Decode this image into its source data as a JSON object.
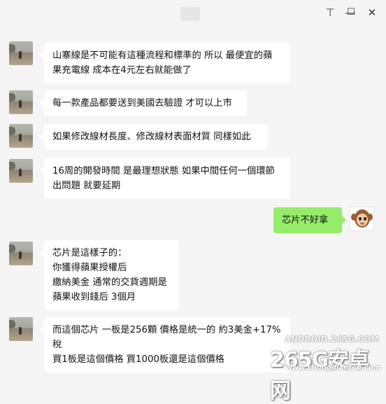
{
  "window": {
    "controls": {
      "pin": "⊤",
      "minimize": "—",
      "maximize": "☐",
      "close": "✕"
    }
  },
  "messages": [
    {
      "side": "left",
      "avatar": "beach-avatar",
      "text": "山寨線是不可能有這種流程和標準的 所以 最便宜的蘋\n果充電線 成本在4元左右就能做了"
    },
    {
      "side": "left",
      "avatar": "beach-avatar",
      "text": "每一款產品都要送到美國去驗證 才可以上市"
    },
    {
      "side": "left",
      "avatar": "beach-avatar",
      "text": "如果修改線材長度、修改線材表面材質 同樣如此"
    },
    {
      "side": "left",
      "avatar": "beach-avatar",
      "text": "16周的開發時間 是最理想狀態 如果中間任何一個環節\n出問題 就要延期"
    },
    {
      "side": "right",
      "avatar": "monkey-avatar",
      "text": "芯片不好拿"
    },
    {
      "side": "left",
      "avatar": "beach-avatar",
      "text": "芯片是這樣子的：\n你獲得蘋果授權后\n繳納美金 通常的交貨週期是\n蘋果收到錢后 3個月"
    },
    {
      "side": "left",
      "avatar": "beach-avatar",
      "text": "而這個芯片 一板是256顆 價格是統一的 約3美金+17%\n稅\n買1板是這個價格 買1000板還是這個價格"
    }
  ],
  "watermark": {
    "top": "ANDROID.265G.COM",
    "main": "265G安卓网",
    "bottom": "www.chongdiantou.com"
  },
  "colors": {
    "background": "#f5f5f5",
    "bubble_left": "#ffffff",
    "bubble_right": "#95ec69"
  }
}
